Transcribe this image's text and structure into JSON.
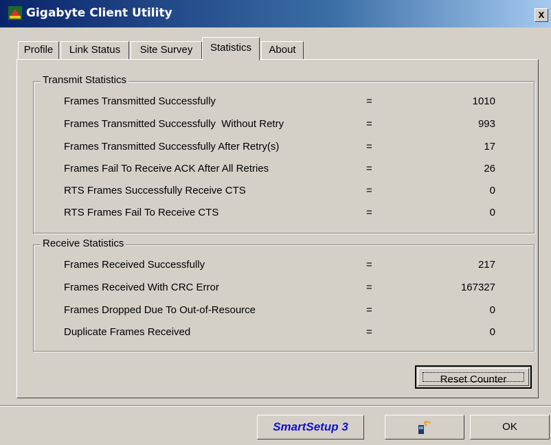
{
  "window": {
    "title": "Gigabyte Client Utility",
    "close_label": "x"
  },
  "tabs": [
    {
      "label": "Profile"
    },
    {
      "label": "Link Status"
    },
    {
      "label": "Site Survey"
    },
    {
      "label": "Statistics"
    },
    {
      "label": "About"
    }
  ],
  "transmit": {
    "title": "Transmit Statistics",
    "rows": [
      {
        "label": "Frames Transmitted Successfully",
        "eq": "=",
        "value": "1010"
      },
      {
        "label": "Frames Transmitted Successfully  Without Retry",
        "eq": "=",
        "value": "993"
      },
      {
        "label": "Frames Transmitted Successfully After Retry(s)",
        "eq": "=",
        "value": "17"
      },
      {
        "label": "Frames Fail To Receive ACK After All Retries",
        "eq": "=",
        "value": "26"
      },
      {
        "label": "RTS Frames Successfully Receive CTS",
        "eq": "=",
        "value": "0"
      },
      {
        "label": "RTS Frames Fail To Receive CTS",
        "eq": "=",
        "value": "0"
      }
    ]
  },
  "receive": {
    "title": "Receive Statistics",
    "rows": [
      {
        "label": "Frames Received Successfully",
        "eq": "=",
        "value": "217"
      },
      {
        "label": "Frames Received With CRC Error",
        "eq": "=",
        "value": "167327"
      },
      {
        "label": "Frames Dropped Due To Out-of-Resource",
        "eq": "=",
        "value": "0"
      },
      {
        "label": "Duplicate Frames Received",
        "eq": "=",
        "value": "0"
      }
    ]
  },
  "buttons": {
    "reset": "Reset Counter",
    "smartsetup": "SmartSetup 3",
    "ok": "OK"
  },
  "icons": {
    "app": "gigabyte-logo-icon",
    "wireless": "wireless-card-icon"
  },
  "colors": {
    "title_bar": "#0a246a",
    "smartsetup_text": "#1010d0",
    "face": "#d4d0c8"
  }
}
